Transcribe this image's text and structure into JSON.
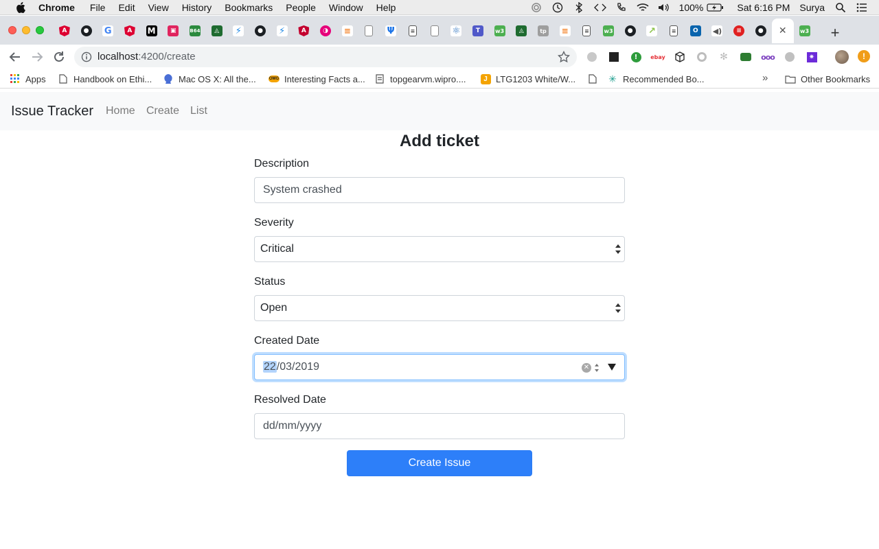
{
  "os_menubar": {
    "items": [
      "Chrome",
      "File",
      "Edit",
      "View",
      "History",
      "Bookmarks",
      "People",
      "Window",
      "Help"
    ],
    "battery": "100%",
    "clock": "Sat 6:16 PM",
    "user": "Surya"
  },
  "browser": {
    "url_host": "localhost",
    "url_path": ":4200/create",
    "new_tab": "+",
    "bookmarks": [
      {
        "label": "Apps",
        "icon": "apps-grid-icon"
      },
      {
        "label": "Handbook on Ethi...",
        "icon": "page-icon"
      },
      {
        "label": "Mac OS X: All the...",
        "icon": "github-octocat-icon"
      },
      {
        "label": "Interesting Facts a...",
        "icon": "omg-icon"
      },
      {
        "label": "topgearvm.wipro....",
        "icon": "page-icon"
      },
      {
        "label": "LTG1203 White/W...",
        "icon": "jira-icon"
      },
      {
        "label": "",
        "icon": "page-icon"
      },
      {
        "label": "Recommended Bo...",
        "icon": "network-icon"
      },
      {
        "label": "Other Bookmarks",
        "icon": "folder-icon"
      }
    ],
    "bookmarks_more": "»",
    "extension_badges": {
      "ebay": "ebay"
    }
  },
  "app": {
    "brand": "Issue Tracker",
    "nav": [
      "Home",
      "Create",
      "List"
    ]
  },
  "form": {
    "title": "Add ticket",
    "description_label": "Description",
    "description_value": "System crashed",
    "severity_label": "Severity",
    "severity_value": "Critical",
    "status_label": "Status",
    "status_value": "Open",
    "created_label": "Created Date",
    "created_day": "22",
    "created_rest": "/03/2019",
    "resolved_label": "Resolved Date",
    "resolved_placeholder": "dd/mm/yyyy",
    "submit_label": "Create Issue"
  },
  "colors": {
    "primary": "#2d7ff9",
    "navbar_bg": "#f8f9fa",
    "focus_ring": "#80bdff"
  }
}
